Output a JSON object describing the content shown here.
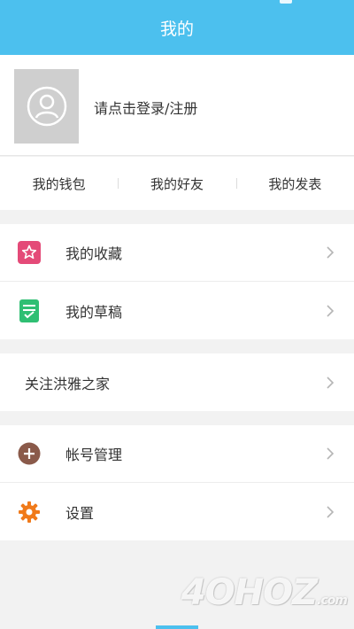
{
  "header": {
    "title": "我的"
  },
  "profile": {
    "login_text": "请点击登录/注册"
  },
  "quick_links": [
    {
      "label": "我的钱包"
    },
    {
      "label": "我的好友"
    },
    {
      "label": "我的发表"
    }
  ],
  "menu_group_1": [
    {
      "label": "我的收藏",
      "icon": "star-icon",
      "color": "#e44a78"
    },
    {
      "label": "我的草稿",
      "icon": "draft-icon",
      "color": "#2fbf73"
    }
  ],
  "menu_group_2": [
    {
      "label": "关注洪雅之家"
    }
  ],
  "menu_group_3": [
    {
      "label": "帐号管理",
      "icon": "plus-circle-icon",
      "color": "#8a5a4a"
    },
    {
      "label": "设置",
      "icon": "gear-icon",
      "color": "#f07a1a"
    }
  ],
  "watermark": {
    "text": "4OHOZ",
    "suffix": ".com"
  },
  "colors": {
    "primary": "#4cc0ee",
    "background": "#f2f2f2"
  }
}
